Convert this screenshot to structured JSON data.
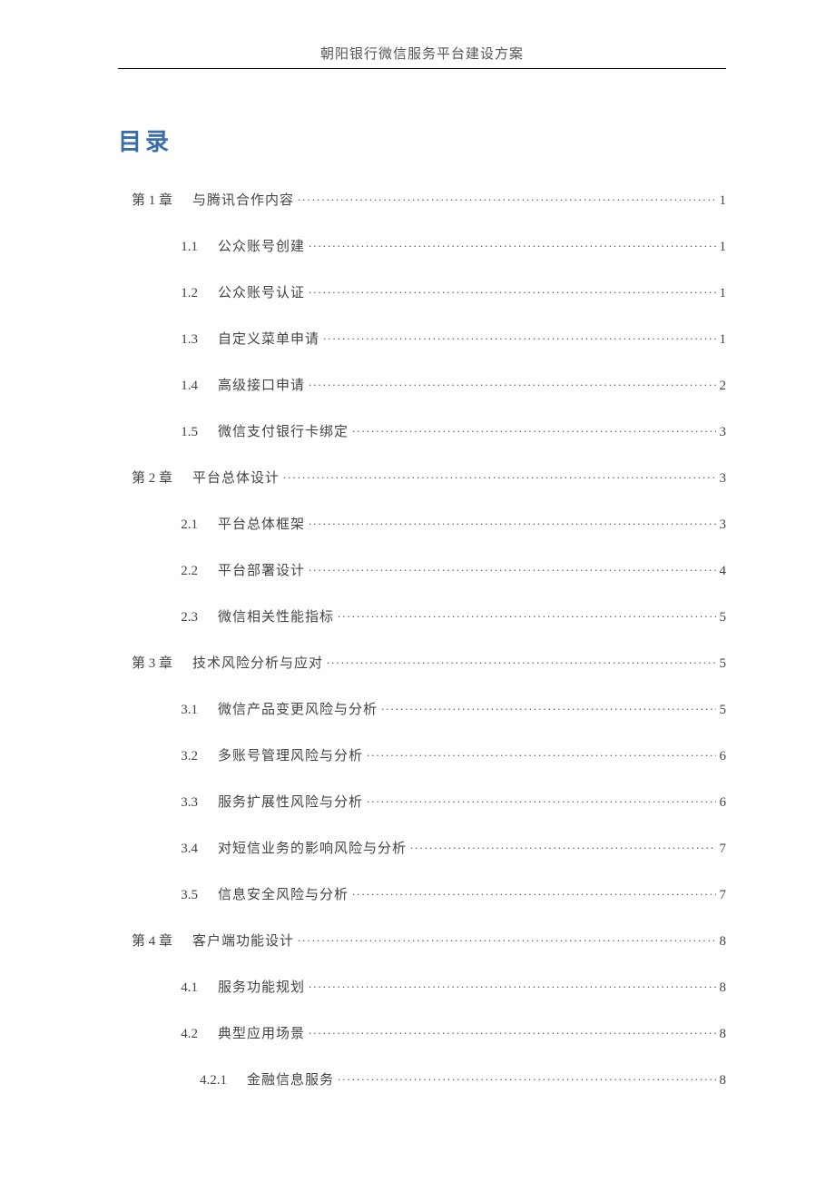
{
  "header_title": "朝阳银行微信服务平台建设方案",
  "toc_heading": "目录",
  "entries": [
    {
      "level": 1,
      "num": "第 1 章",
      "title": "与腾讯合作内容",
      "page": "1"
    },
    {
      "level": 2,
      "num": "1.1",
      "title": "公众账号创建",
      "page": "1"
    },
    {
      "level": 2,
      "num": "1.2",
      "title": "公众账号认证",
      "page": "1"
    },
    {
      "level": 2,
      "num": "1.3",
      "title": "自定义菜单申请",
      "page": "1"
    },
    {
      "level": 2,
      "num": "1.4",
      "title": "高级接口申请",
      "page": "2"
    },
    {
      "level": 2,
      "num": "1.5",
      "title": "微信支付银行卡绑定",
      "page": "3"
    },
    {
      "level": 1,
      "num": "第 2 章",
      "title": "平台总体设计",
      "page": "3"
    },
    {
      "level": 2,
      "num": "2.1",
      "title": "平台总体框架",
      "page": "3"
    },
    {
      "level": 2,
      "num": "2.2",
      "title": "平台部署设计",
      "page": "4"
    },
    {
      "level": 2,
      "num": "2.3",
      "title": "微信相关性能指标",
      "page": "5"
    },
    {
      "level": 1,
      "num": "第 3 章",
      "title": "技术风险分析与应对",
      "page": "5"
    },
    {
      "level": 2,
      "num": "3.1",
      "title": "微信产品变更风险与分析",
      "page": "5"
    },
    {
      "level": 2,
      "num": "3.2",
      "title": "多账号管理风险与分析",
      "page": "6"
    },
    {
      "level": 2,
      "num": "3.3",
      "title": "服务扩展性风险与分析",
      "page": "6"
    },
    {
      "level": 2,
      "num": "3.4",
      "title": "对短信业务的影响风险与分析",
      "page": "7"
    },
    {
      "level": 2,
      "num": "3.5",
      "title": "信息安全风险与分析",
      "page": "7"
    },
    {
      "level": 1,
      "num": "第 4 章",
      "title": "客户端功能设计",
      "page": "8"
    },
    {
      "level": 2,
      "num": "4.1",
      "title": "服务功能规划",
      "page": "8"
    },
    {
      "level": 2,
      "num": "4.2",
      "title": "典型应用场景",
      "page": "8"
    },
    {
      "level": 3,
      "num": "4.2.1",
      "title": "金融信息服务",
      "page": "8"
    }
  ]
}
